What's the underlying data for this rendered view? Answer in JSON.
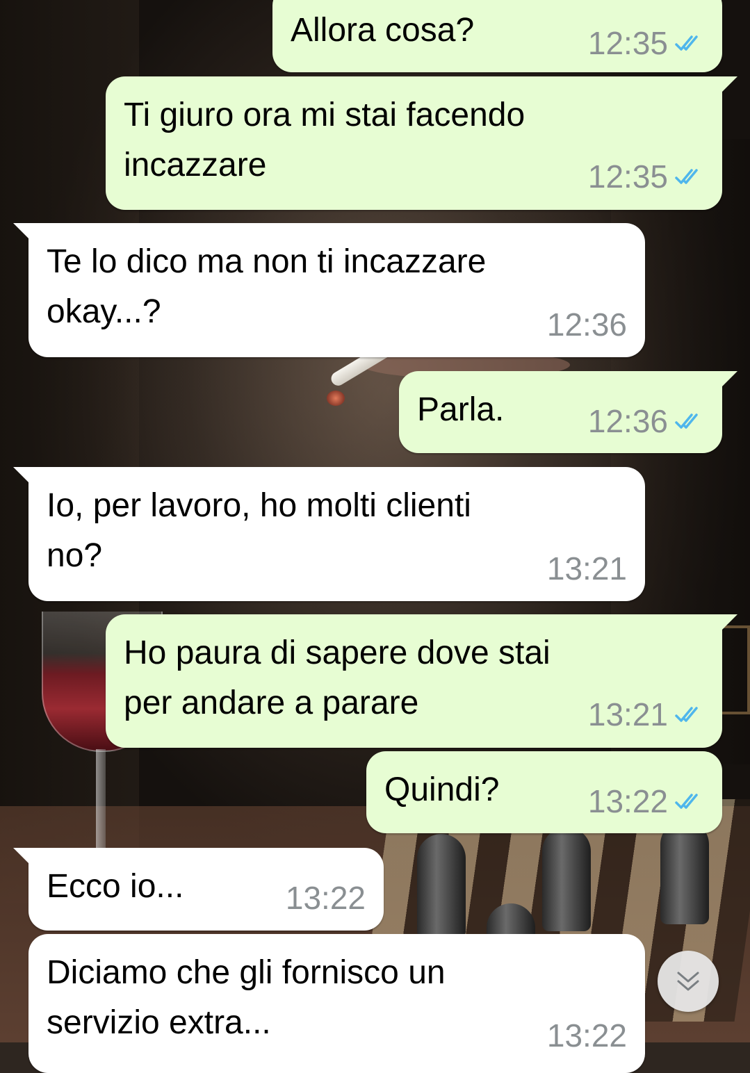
{
  "colors": {
    "outgoing_bubble": "#e7fdd3",
    "incoming_bubble": "#ffffff",
    "timestamp": "#8a8f92",
    "read_ticks": "#4fb6ec"
  },
  "icons": {
    "read_receipt": "double-check-icon",
    "scroll_down": "chevron-double-down-icon"
  },
  "messages": [
    {
      "direction": "out",
      "lines": [
        "Allora cosa?"
      ],
      "time": "12:35",
      "read": true
    },
    {
      "direction": "out",
      "lines": [
        "Ti giuro ora mi stai facendo",
        "incazzare"
      ],
      "time": "12:35",
      "read": true
    },
    {
      "direction": "in",
      "lines": [
        "Te lo dico ma non ti incazzare",
        "okay...?"
      ],
      "time": "12:36"
    },
    {
      "direction": "out",
      "lines": [
        "Parla."
      ],
      "time": "12:36",
      "read": true
    },
    {
      "direction": "in",
      "lines": [
        "Io, per lavoro, ho molti clienti",
        "no?"
      ],
      "time": "13:21"
    },
    {
      "direction": "out",
      "lines": [
        "Ho paura di sapere dove stai",
        "per andare a parare"
      ],
      "time": "13:21",
      "read": true
    },
    {
      "direction": "out",
      "lines": [
        "Quindi?"
      ],
      "time": "13:22",
      "read": true
    },
    {
      "direction": "in",
      "lines": [
        "Ecco io..."
      ],
      "time": "13:22"
    },
    {
      "direction": "in",
      "lines": [
        "Diciamo che gli fornisco un",
        "servizio extra..."
      ],
      "time": "13:22"
    }
  ]
}
